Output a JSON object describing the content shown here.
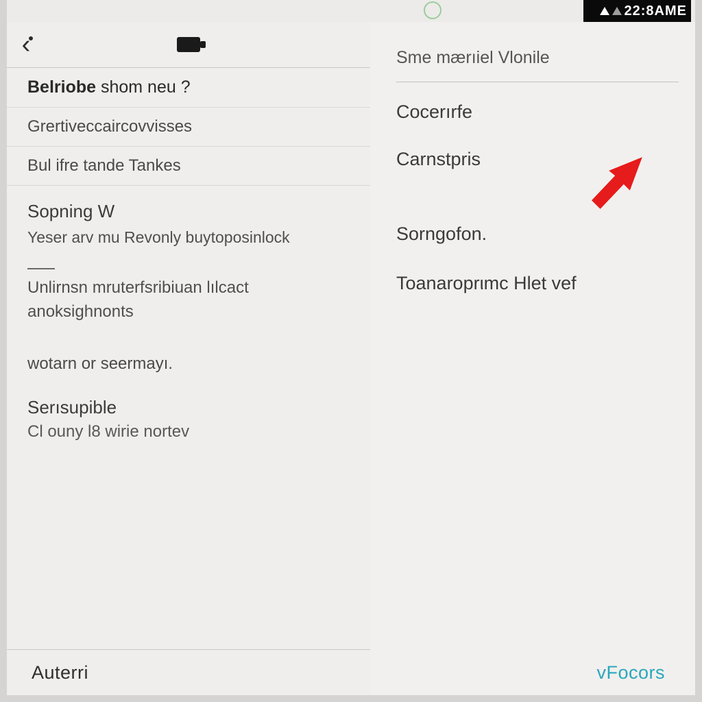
{
  "statusbar": {
    "clock": "22:8AME"
  },
  "left": {
    "heading": {
      "bold": "Belriobe",
      "rest": " shom neu ?"
    },
    "rows": {
      "r1": "Grertiveccaircovvisses",
      "r2": "Bul ifre tande Tankes"
    },
    "section1": {
      "title": "Sopning W",
      "sub": "Yeser arv mu Revonly buytoposinlock"
    },
    "para": "Unlirnsn mruterfsribiuan lılcact anoksighnonts",
    "item1": "wotarn or seermayı.",
    "item2_title": "Serısupible",
    "item2_sub": "Cl ouny l8 wirie nortev"
  },
  "leftFooter": "Auterri",
  "right": {
    "head": "Sme mærıiel Vlonile",
    "i1": "Cocerırfe",
    "i2": "Carnstpris",
    "i3": "Sorngofon.",
    "i4": "Toanaroprιmc Hlet vef"
  },
  "rightFooter": "vFocors"
}
